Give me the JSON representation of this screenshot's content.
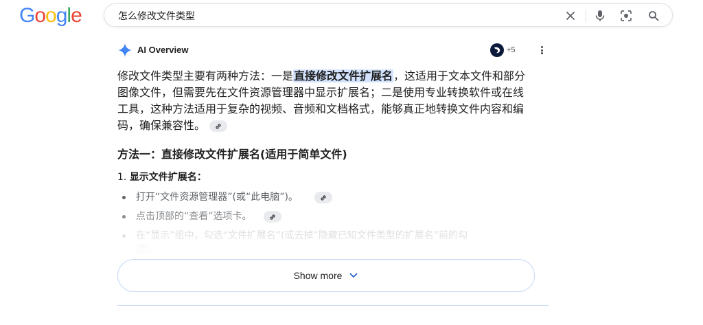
{
  "logo": {
    "letters": [
      "G",
      "o",
      "o",
      "g",
      "l",
      "e"
    ],
    "colors": [
      "#4285F4",
      "#EA4335",
      "#FBBC05",
      "#4285F4",
      "#34A853",
      "#EA4335"
    ]
  },
  "search": {
    "query": "怎么修改文件类型",
    "icons": [
      "close-icon",
      "microphone-icon",
      "lens-icon",
      "search-icon"
    ]
  },
  "overview": {
    "title": "AI Overview",
    "sources_count": "+5",
    "summary": {
      "before": "修改文件类型主要有两种方法：一是",
      "highlight": "直接修改文件扩展名",
      "after": "，这适用于文本文件和部分图像文件，但需要先在文件资源管理器中显示扩展名；二是使用专业转换软件或在线工具，这种方法适用于复杂的视频、音频和文档格式，能够真正地转换文件内容和编码，确保兼容性。"
    },
    "method_heading": "方法一：直接修改文件扩展名(适用于简单文件)",
    "step": {
      "number": "1.",
      "title": "显示文件扩展名："
    },
    "bullets": [
      {
        "text": "打开“文件资源管理器”(或“此电脑”)。",
        "color": "#5f6368"
      },
      {
        "text": "点击顶部的“查看”选项卡。",
        "color": "#8a8d91"
      },
      {
        "text": "在“显示”组中，勾选“文件扩展名”(或去掉“隐藏已知文件类型的扩展名”前的勾",
        "color": "#c4c7c5"
      },
      {
        "text": "选)。",
        "color": "#e3e3e3"
      }
    ],
    "show_more": "Show more",
    "accent": "#4285F4"
  }
}
